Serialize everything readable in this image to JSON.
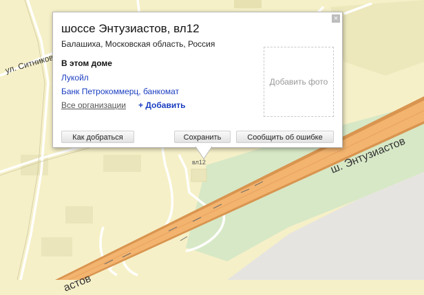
{
  "map": {
    "street_labels": {
      "ul_sitnikova": "ул. Ситникова",
      "main_highway": "ш. Энтузиастов",
      "bottom_highway": "астов"
    },
    "house_number": "вл12",
    "colors": {
      "background": "#f6f0c8",
      "highway": "#f3b46f",
      "highway_edge": "#d99550",
      "green": "#d7e8c6",
      "gray_area": "#e6e4e0",
      "roads": "#ffffff",
      "buildings": "#e9e3b6"
    }
  },
  "balloon": {
    "title": "шоссе Энтузиастов, вл12",
    "subtitle": "Балашиха, Московская область, Россия",
    "house_section_heading": "В этом доме",
    "organizations": [
      "Лукойл",
      "Банк Петрокоммерц, банкомат"
    ],
    "all_organizations_link": "Все организации",
    "add_link": "+ Добавить",
    "add_photo": "Добавить фото",
    "close_icon": "×",
    "buttons": {
      "route": "Как добраться",
      "save": "Сохранить",
      "report": "Сообщить об ошибке"
    }
  }
}
